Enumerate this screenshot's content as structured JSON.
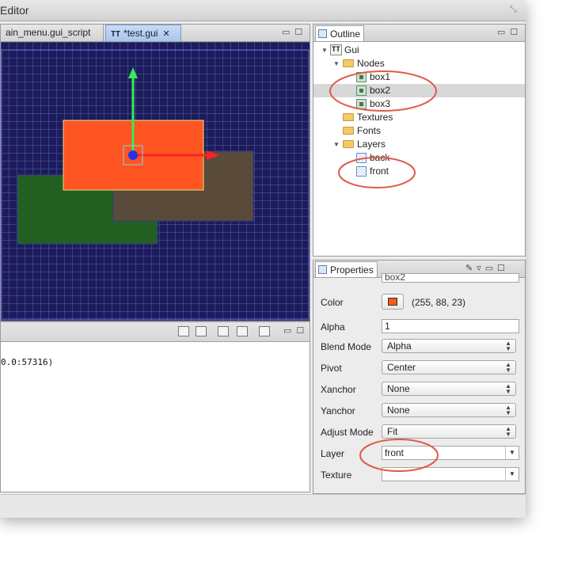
{
  "window": {
    "title": "Editor"
  },
  "editor": {
    "tabs": [
      {
        "label": "ain_menu.gui_script"
      },
      {
        "label": "*test.gui",
        "icon": "TT"
      }
    ]
  },
  "console": {
    "output": "0.0:57316)"
  },
  "outline": {
    "tab_label": "Outline",
    "tree": {
      "root": "Gui",
      "nodes_label": "Nodes",
      "nodes": [
        "box1",
        "box2",
        "box3"
      ],
      "textures_label": "Textures",
      "fonts_label": "Fonts",
      "layers_label": "Layers",
      "layers": [
        "back",
        "front"
      ]
    }
  },
  "properties": {
    "tab_label": "Properties",
    "id_value": "box2",
    "color": {
      "label": "Color",
      "value": "(255, 88, 23)",
      "swatch": "#ff5817"
    },
    "alpha": {
      "label": "Alpha",
      "value": "1"
    },
    "blend_mode": {
      "label": "Blend Mode",
      "value": "Alpha"
    },
    "pivot": {
      "label": "Pivot",
      "value": "Center"
    },
    "xanchor": {
      "label": "Xanchor",
      "value": "None"
    },
    "yanchor": {
      "label": "Yanchor",
      "value": "None"
    },
    "adjust_mode": {
      "label": "Adjust Mode",
      "value": "Fit"
    },
    "layer": {
      "label": "Layer",
      "value": "front"
    },
    "texture": {
      "label": "Texture",
      "value": ""
    }
  },
  "colors": {
    "canvas_bg": "#1c1c5c",
    "box1": "#226022",
    "box2": "#ff5522",
    "box3": "#5a4a3a",
    "annotation": "#e05a4a"
  }
}
